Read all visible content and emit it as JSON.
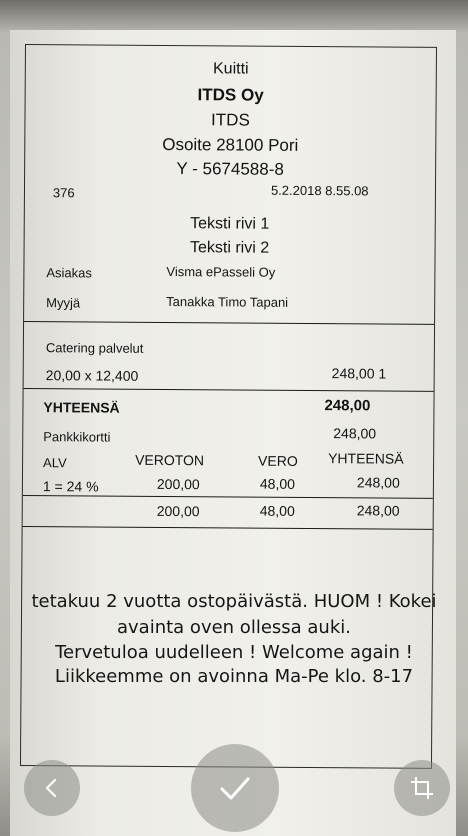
{
  "receipt": {
    "title": "Kuitti",
    "company_name": "ITDS Oy",
    "company_short": "ITDS",
    "address": "Osoite 28100 Pori",
    "business_id": "Y - 5674588-8",
    "receipt_number": "376",
    "datetime": "5.2.2018 8.55.08",
    "text_line_1": "Teksti rivi 1",
    "text_line_2": "Teksti rivi 2",
    "customer_label": "Asiakas",
    "customer_value": "Visma ePasseli Oy",
    "seller_label": "Myyjä",
    "seller_value": "Tanakka Timo Tapani",
    "item": {
      "name": "Catering palvelut",
      "qty_price": "20,00  x 12,400",
      "amount": "248,00 1"
    },
    "total_label": "YHTEENSÄ",
    "total_value": "248,00",
    "payment_label": "Pankkikortti",
    "payment_value": "248,00",
    "vat_table": {
      "headers": [
        "ALV",
        "VEROTON",
        "VERO",
        "YHTEENSÄ"
      ],
      "row": [
        "1 = 24 %",
        "200,00",
        "48,00",
        "248,00"
      ],
      "totals": [
        "200,00",
        "48,00",
        "248,00"
      ]
    },
    "footer": [
      "tetakuu 2 vuotta ostopäivästä. HUOM ! Kokei",
      "avainta oven ollessa auki.",
      "Tervetuloa uudelleen ! Welcome again !",
      "Liikkeemme on avoinna Ma-Pe klo. 8-17"
    ]
  },
  "toolbar": {
    "back_icon": "chevron-left-icon",
    "confirm_icon": "checkmark-icon",
    "crop_icon": "crop-icon"
  }
}
